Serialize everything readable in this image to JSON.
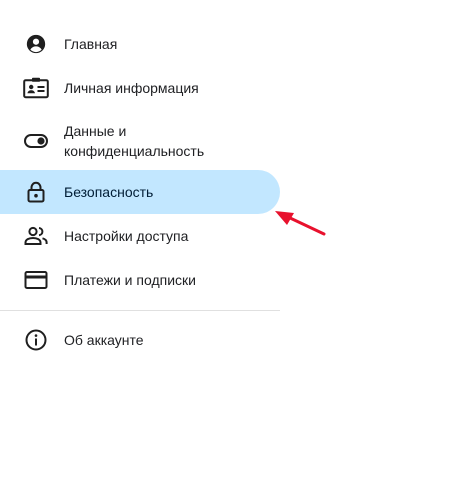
{
  "nav": {
    "items": [
      {
        "label": "Главная",
        "icon": "account-circle-icon"
      },
      {
        "label": "Личная информация",
        "icon": "badge-icon"
      },
      {
        "label": "Данные и конфиденциальность",
        "icon": "toggle-icon"
      },
      {
        "label": "Безопасность",
        "icon": "lock-icon",
        "active": true
      },
      {
        "label": "Настройки доступа",
        "icon": "people-icon"
      },
      {
        "label": "Платежи и подписки",
        "icon": "credit-card-icon"
      }
    ],
    "footer_items": [
      {
        "label": "Об аккаунте",
        "icon": "info-icon"
      }
    ]
  },
  "colors": {
    "active_bg": "#c2e7ff",
    "text": "#202124",
    "icon": "#1f1f1f",
    "annotation": "#e8112d",
    "divider": "#e0e0e0"
  }
}
